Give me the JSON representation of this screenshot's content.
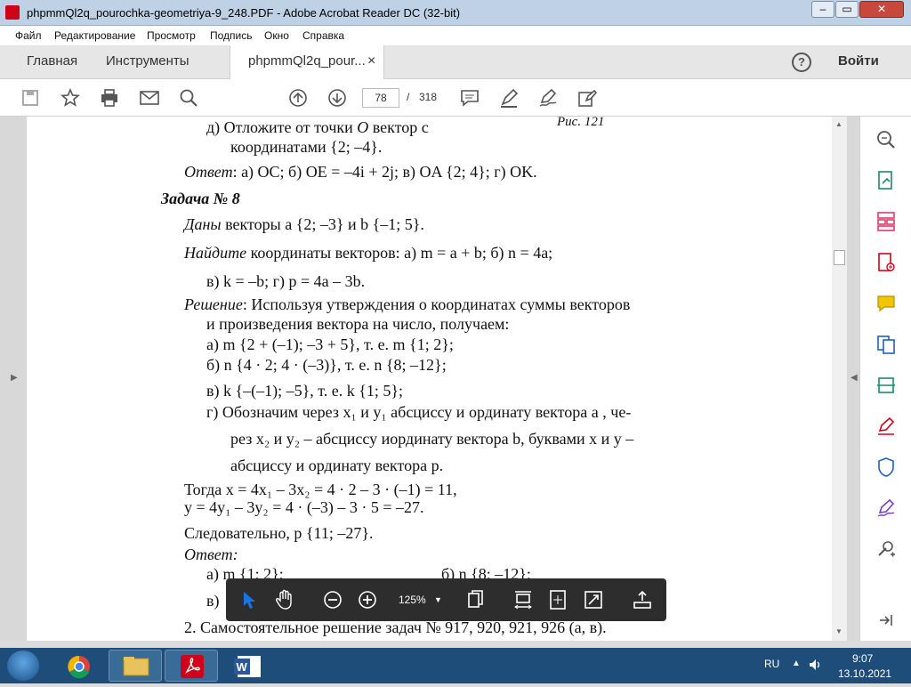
{
  "window": {
    "title": "phpmmQl2q_pourochka-geometriya-9_248.PDF - Adobe Acrobat Reader DC (32-bit)"
  },
  "menu": [
    "Файл",
    "Редактирование",
    "Просмотр",
    "Подпись",
    "Окно",
    "Справка"
  ],
  "tabs": {
    "home": "Главная",
    "tools": "Инструменты",
    "doc": "phpmmQl2q_pour...",
    "close": "×",
    "help": "?",
    "signin": "Войти"
  },
  "toolbar": {
    "page_current": "78",
    "page_sep": "/",
    "page_total": "318"
  },
  "content": {
    "l1a": "д) Отложите от точки ",
    "l1b": "O",
    "l1c": " вектор с",
    "fig": "Рис. 121",
    "l2": "координатами {2; –4}.",
    "l3a": "Ответ",
    "l3b": ": а) OC; б) OE = –4i + 2j; в) OA {2; 4}; г) OK.",
    "l4": "Задача № 8",
    "l5a": "Даны",
    "l5b": " векторы a {2; –3} и b {–1; 5}.",
    "l6a": "Найдите",
    "l6b": " координаты векторов: а) m = a + b; б) n = 4a;",
    "l7": "в) k = –b; г) p = 4a – 3b.",
    "l8a": "Решение",
    "l8b": ": Используя утверждения о координатах суммы векторов",
    "l9": "и произведения вектора на число, получаем:",
    "l10": "а) m {2 + (–1); –3 + 5}, т. е. m {1; 2};",
    "l11": "б) n {4 · 2; 4 · (–3)}, т. е. n {8; –12};",
    "l12": "в) k {–(–1); –5}, т. е. k {1; 5};",
    "l13": "г) Обозначим через x₁ и y₁ абсциссу и ординату вектора a , че-",
    "l14": "рез x₂ и y₂ – абсциссу иординату вектора b, буквами x и y –",
    "l15": "абсциссу и ординату вектора p.",
    "l16": "Тогда x = 4x₁ – 3x₂ = 4 · 2 – 3 · (–1) = 11,",
    "l17": "y = 4y₁ – 3y₂ = 4 · (–3) – 3 · 5 = –27.",
    "l18": "Следовательно, p {11; –27}.",
    "l19": "Ответ:",
    "l20a": "а) m {1; 2};",
    "l20b": "б) n {8; –12};",
    "l21": "в)",
    "l22": "2. Самостоятельное решение задач № 917, 920, 921, 926 (а, в)."
  },
  "floatbar": {
    "zoom": "125%"
  },
  "taskbar": {
    "lang": "RU",
    "time": "9:07",
    "date": "13.10.2021"
  },
  "colors": {
    "accent": "#1a73e8",
    "pdf_red": "#d0021b",
    "taskbar": "#1f4d79"
  }
}
